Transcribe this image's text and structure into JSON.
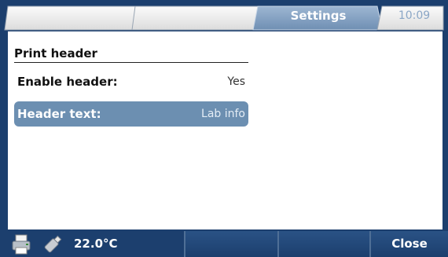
{
  "tabs": {
    "active_label": "Settings",
    "clock": "10:09"
  },
  "section": {
    "title": "Print header"
  },
  "settings_rows": [
    {
      "label": "Enable header:",
      "value": "Yes",
      "selected": false
    },
    {
      "label": "Header text:",
      "value": "Lab info",
      "selected": true
    }
  ],
  "status": {
    "temperature": "22.0°C",
    "icons": [
      "printer-icon",
      "usb-stick-icon"
    ]
  },
  "softkeys": [
    "",
    "",
    "",
    "Close"
  ],
  "colors": {
    "bar": "#1c3f6e",
    "active_tab": "#8aa6c6",
    "inactive_tab": "#eeeeee",
    "selected_row": "#6c8fb1"
  }
}
